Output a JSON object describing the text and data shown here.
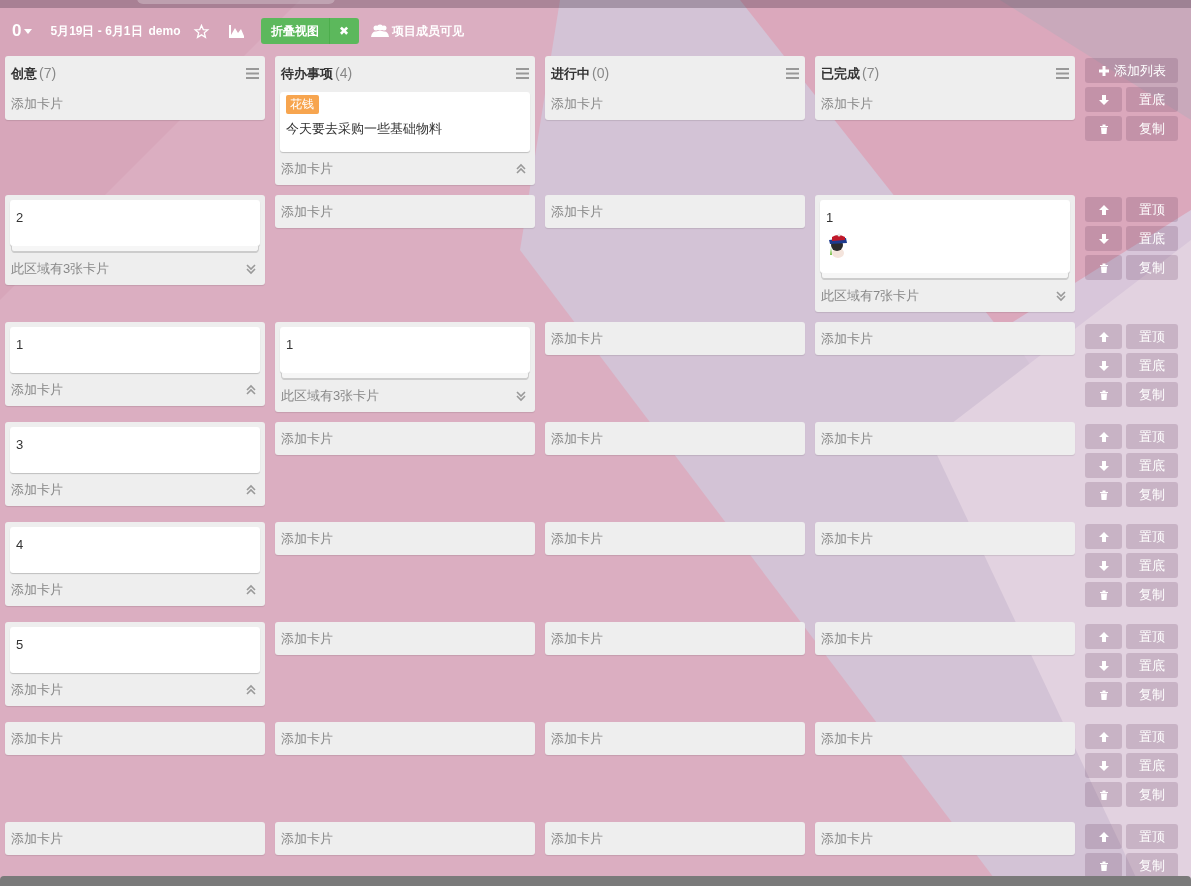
{
  "toolbar": {
    "board_number": "0",
    "date_range": "5月19日 - 6月1日",
    "board_name": "demo",
    "fold_button": "折叠视图",
    "close_button": "✖",
    "visibility": "项目成员可见"
  },
  "lists": [
    {
      "title": "创意",
      "count": "(7)"
    },
    {
      "title": "待办事项",
      "count": "(4)"
    },
    {
      "title": "进行中",
      "count": "(0)"
    },
    {
      "title": "已完成",
      "count": "(7)"
    }
  ],
  "rows": [
    {
      "cells": [
        {
          "footer": "添加卡片"
        },
        {
          "cards": [
            {
              "label": {
                "text": "花钱",
                "color": "#f7a54f"
              },
              "text": "今天要去采购一些基础物料"
            }
          ],
          "footer": "添加卡片",
          "expanded": true
        },
        {
          "footer": "添加卡片"
        },
        {
          "footer": "添加卡片"
        }
      ],
      "actions": [
        {
          "kind": "add",
          "label": "添加列表"
        },
        {
          "kind": "down",
          "label": "置底"
        },
        {
          "kind": "delete",
          "label": "复制"
        }
      ]
    },
    {
      "cells": [
        {
          "cards": [
            {
              "text": "2"
            }
          ],
          "stacked": true,
          "footer": "此区域有3张卡片",
          "expanded": false
        },
        {
          "footer": "添加卡片"
        },
        {
          "footer": "添加卡片"
        },
        {
          "cards": [
            {
              "text": "1"
            }
          ],
          "stacked": true,
          "footer": "此区域有7张卡片",
          "expanded": false
        }
      ],
      "actions": [
        {
          "kind": "up",
          "label": "置顶"
        },
        {
          "kind": "down",
          "label": "置底"
        },
        {
          "kind": "delete",
          "label": "复制"
        }
      ]
    },
    {
      "cells": [
        {
          "cards": [
            {
              "text": "1"
            }
          ],
          "footer": "添加卡片",
          "expanded": true
        },
        {
          "cards": [
            {
              "text": "1"
            }
          ],
          "stacked": true,
          "footer": "此区域有3张卡片",
          "expanded": false
        },
        {
          "footer": "添加卡片"
        },
        {
          "footer": "添加卡片"
        }
      ],
      "actions": [
        {
          "kind": "up",
          "label": "置顶"
        },
        {
          "kind": "down",
          "label": "置底"
        },
        {
          "kind": "delete",
          "label": "复制"
        }
      ]
    },
    {
      "cells": [
        {
          "cards": [
            {
              "text": "3"
            }
          ],
          "footer": "添加卡片",
          "expanded": true
        },
        {
          "footer": "添加卡片"
        },
        {
          "footer": "添加卡片"
        },
        {
          "footer": "添加卡片"
        }
      ],
      "actions": [
        {
          "kind": "up",
          "label": "置顶"
        },
        {
          "kind": "down",
          "label": "置底"
        },
        {
          "kind": "delete",
          "label": "复制"
        }
      ]
    },
    {
      "cells": [
        {
          "cards": [
            {
              "text": "4"
            }
          ],
          "footer": "添加卡片",
          "expanded": true
        },
        {
          "footer": "添加卡片"
        },
        {
          "footer": "添加卡片"
        },
        {
          "footer": "添加卡片"
        }
      ],
      "actions": [
        {
          "kind": "up",
          "label": "置顶"
        },
        {
          "kind": "down",
          "label": "置底"
        },
        {
          "kind": "delete",
          "label": "复制"
        }
      ]
    },
    {
      "cells": [
        {
          "cards": [
            {
              "text": "5"
            }
          ],
          "footer": "添加卡片",
          "expanded": true
        },
        {
          "footer": "添加卡片"
        },
        {
          "footer": "添加卡片"
        },
        {
          "footer": "添加卡片"
        }
      ],
      "actions": [
        {
          "kind": "up",
          "label": "置顶"
        },
        {
          "kind": "down",
          "label": "置底"
        },
        {
          "kind": "delete",
          "label": "复制"
        }
      ]
    },
    {
      "cells": [
        {
          "footer": "添加卡片"
        },
        {
          "footer": "添加卡片"
        },
        {
          "footer": "添加卡片"
        },
        {
          "footer": "添加卡片"
        }
      ],
      "actions": [
        {
          "kind": "up",
          "label": "置顶"
        },
        {
          "kind": "down",
          "label": "置底"
        },
        {
          "kind": "delete",
          "label": "复制"
        }
      ]
    },
    {
      "cells": [
        {
          "footer": "添加卡片"
        },
        {
          "footer": "添加卡片"
        },
        {
          "footer": "添加卡片"
        },
        {
          "footer": "添加卡片"
        }
      ],
      "actions": [
        {
          "kind": "up",
          "label": "置顶"
        },
        {
          "kind": "delete",
          "label": "复制"
        }
      ]
    }
  ]
}
